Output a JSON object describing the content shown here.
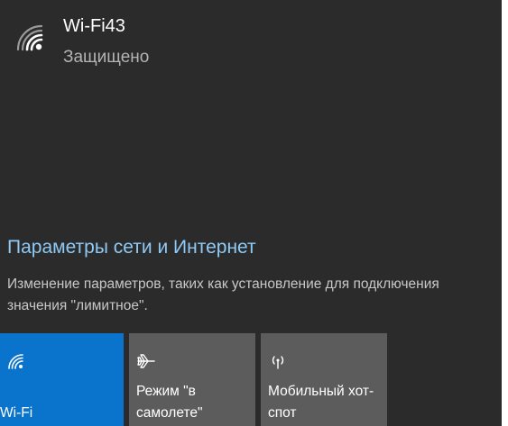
{
  "network": {
    "icon": "wifi-signal-icon",
    "name": "Wi-Fi43",
    "status": "Защищено"
  },
  "settings": {
    "link_label": "Параметры сети и Интернет",
    "description": "Изменение параметров, таких как установление для подключения значения \"лимитное\"."
  },
  "tiles": [
    {
      "icon": "wifi-icon",
      "label": "Wi-Fi",
      "active": true,
      "color": "#0a74cc"
    },
    {
      "icon": "airplane-icon",
      "label": "Режим \"в самолете\"",
      "active": false,
      "color": "#5c5c5c"
    },
    {
      "icon": "hotspot-icon",
      "label": "Мобильный хот-спот",
      "active": false,
      "color": "#5c5c5c"
    }
  ],
  "colors": {
    "panel_bg": "#2b2b2b",
    "link": "#8fc9f5",
    "accent": "#0a74cc",
    "tile_inactive": "#5c5c5c"
  }
}
